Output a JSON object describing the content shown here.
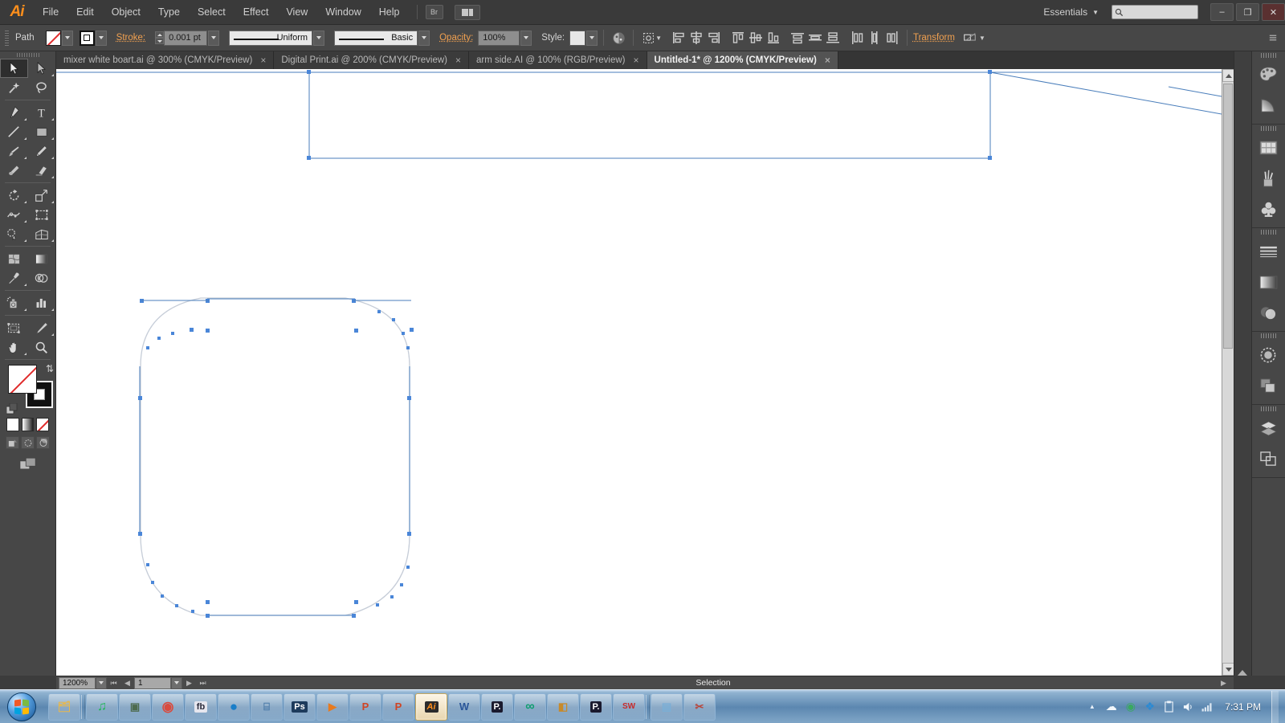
{
  "app": {
    "name": "Adobe Illustrator",
    "logo": "Ai",
    "bridge_label": "Br"
  },
  "menubar": {
    "items": [
      "File",
      "Edit",
      "Object",
      "Type",
      "Select",
      "Effect",
      "View",
      "Window",
      "Help"
    ],
    "workspace": "Essentials",
    "search_placeholder": "",
    "window_buttons": {
      "minimize": "–",
      "restore": "❐",
      "close": "✕"
    }
  },
  "controlbar": {
    "object_label": "Path",
    "fill_label": "",
    "stroke_label": "Stroke:",
    "stroke_weight": "0.001 pt",
    "stroke_profile": "Uniform",
    "brush_definition": "Basic",
    "opacity_label": "Opacity:",
    "opacity_value": "100%",
    "style_label": "Style:",
    "transform_label": "Transform",
    "align_icons": [
      "align-left-icon",
      "align-center-horizontal-icon",
      "align-right-icon",
      "align-top-icon",
      "align-middle-vertical-icon",
      "align-bottom-icon",
      "distribute-top-icon",
      "distribute-center-icon",
      "distribute-bottom-icon",
      "distribute-left-icon",
      "distribute-center-vertical-icon",
      "distribute-right-icon"
    ]
  },
  "tabs": [
    {
      "label": "mixer white boart.ai @ 300% (CMYK/Preview)",
      "active": false,
      "close": "×"
    },
    {
      "label": "Digital Print.ai @ 200% (CMYK/Preview)",
      "active": false,
      "close": "×"
    },
    {
      "label": "arm side.AI @ 100% (RGB/Preview)",
      "active": false,
      "close": "×"
    },
    {
      "label": "Untitled-1* @ 1200% (CMYK/Preview)",
      "active": true,
      "close": "×"
    }
  ],
  "toolbar": {
    "tools": [
      {
        "name": "selection-tool",
        "selected": true,
        "flyout": false
      },
      {
        "name": "direct-selection-tool",
        "selected": false,
        "flyout": true
      },
      {
        "name": "magic-wand-tool",
        "selected": false,
        "flyout": false
      },
      {
        "name": "lasso-tool",
        "selected": false,
        "flyout": false
      },
      {
        "name": "pen-tool",
        "selected": false,
        "flyout": true
      },
      {
        "name": "type-tool",
        "selected": false,
        "flyout": true
      },
      {
        "name": "line-segment-tool",
        "selected": false,
        "flyout": true
      },
      {
        "name": "rectangle-tool",
        "selected": false,
        "flyout": true
      },
      {
        "name": "paintbrush-tool",
        "selected": false,
        "flyout": true
      },
      {
        "name": "pencil-tool",
        "selected": false,
        "flyout": true
      },
      {
        "name": "blob-brush-tool",
        "selected": false,
        "flyout": false
      },
      {
        "name": "eraser-tool",
        "selected": false,
        "flyout": true
      },
      {
        "name": "rotate-tool",
        "selected": false,
        "flyout": true
      },
      {
        "name": "scale-tool",
        "selected": false,
        "flyout": true
      },
      {
        "name": "width-tool",
        "selected": false,
        "flyout": true
      },
      {
        "name": "free-transform-tool",
        "selected": false,
        "flyout": false
      },
      {
        "name": "shape-builder-tool",
        "selected": false,
        "flyout": true
      },
      {
        "name": "perspective-grid-tool",
        "selected": false,
        "flyout": true
      },
      {
        "name": "mesh-tool",
        "selected": false,
        "flyout": false
      },
      {
        "name": "gradient-tool",
        "selected": false,
        "flyout": false
      },
      {
        "name": "eyedropper-tool",
        "selected": false,
        "flyout": true
      },
      {
        "name": "blend-tool",
        "selected": false,
        "flyout": false
      },
      {
        "name": "symbol-sprayer-tool",
        "selected": false,
        "flyout": true
      },
      {
        "name": "column-graph-tool",
        "selected": false,
        "flyout": true
      },
      {
        "name": "artboard-tool",
        "selected": false,
        "flyout": false
      },
      {
        "name": "slice-tool",
        "selected": false,
        "flyout": true
      },
      {
        "name": "hand-tool",
        "selected": false,
        "flyout": true
      },
      {
        "name": "zoom-tool",
        "selected": false,
        "flyout": false
      }
    ],
    "fill_state": "none",
    "stroke_state": "black",
    "color_modes": [
      "color-mode-button",
      "gradient-mode-button",
      "none-mode-button"
    ],
    "draw_modes": [
      "draw-normal-button",
      "draw-behind-button",
      "draw-inside-button"
    ],
    "screen_mode": "screen-mode-button"
  },
  "right_dock": {
    "groups": [
      {
        "items": [
          "color-panel-icon",
          "color-guide-panel-icon"
        ]
      },
      {
        "items": [
          "swatches-panel-icon",
          "brushes-panel-icon",
          "symbols-panel-icon"
        ]
      },
      {
        "items": [
          "stroke-panel-icon",
          "gradient-panel-icon",
          "transparency-panel-icon"
        ]
      },
      {
        "items": [
          "appearance-panel-icon",
          "graphic-styles-panel-icon"
        ]
      },
      {
        "items": [
          "layers-panel-icon",
          "artboards-panel-icon"
        ]
      }
    ],
    "collapse_icon": "expand-panels-icon"
  },
  "statusbar": {
    "zoom_level": "1200%",
    "page_number": "1",
    "status_text": "Selection",
    "nav_first": "⏮",
    "nav_prev": "◀",
    "nav_next": "▶",
    "nav_last": "⏭"
  },
  "canvas": {
    "artboard_background": "#ffffff",
    "selection_color": "#4a7ebb",
    "anchor_color": "#4a86d8",
    "description": "Rounded-square vector path selected with visible anchor points, plus a partial rectangle path at top"
  },
  "taskbar": {
    "start_label": "Start",
    "items": [
      {
        "name": "taskbar-explorer",
        "label": "🗂",
        "color": "#e8b84b",
        "active": false
      },
      {
        "name": "taskbar-spotify",
        "label": "♫",
        "color": "#1db954",
        "active": false
      },
      {
        "name": "taskbar-monitor",
        "label": "▣",
        "color": "#5a7a5a",
        "active": false
      },
      {
        "name": "taskbar-chrome",
        "label": "◉",
        "color": "#d94b3e",
        "active": false
      },
      {
        "name": "taskbar-fb",
        "label": "fb",
        "color": "#2a2a3a",
        "active": false
      },
      {
        "name": "taskbar-teamviewer",
        "label": "●",
        "color": "#1a7ec8",
        "active": false
      },
      {
        "name": "taskbar-contacts",
        "label": "⌸",
        "color": "#4a7aa8",
        "active": false
      },
      {
        "name": "taskbar-photoshop",
        "label": "Ps",
        "color": "#1d3b5c",
        "active": false
      },
      {
        "name": "taskbar-media-player",
        "label": "▶",
        "color": "#e87a1e",
        "active": false
      },
      {
        "name": "taskbar-powerpoint-1",
        "label": "P",
        "color": "#d04423",
        "active": false
      },
      {
        "name": "taskbar-powerpoint-2",
        "label": "P",
        "color": "#d04423",
        "active": false
      },
      {
        "name": "taskbar-illustrator",
        "label": "Ai",
        "color": "#ff8f1c",
        "active": true
      },
      {
        "name": "taskbar-word",
        "label": "W",
        "color": "#2a5699",
        "active": false
      },
      {
        "name": "taskbar-pdf-1",
        "label": "P.",
        "color": "#1a1a2e",
        "active": false
      },
      {
        "name": "taskbar-opera",
        "label": "∞",
        "color": "#0e9e6e",
        "active": false
      },
      {
        "name": "taskbar-picture",
        "label": "◧",
        "color": "#c78a2a",
        "active": false
      },
      {
        "name": "taskbar-pdf-2",
        "label": "P.",
        "color": "#1a1a2e",
        "active": false
      },
      {
        "name": "taskbar-solidworks",
        "label": "SW",
        "color": "#c82a2a",
        "active": false
      },
      {
        "name": "taskbar-calculator",
        "label": "▤",
        "color": "#7aaed6",
        "active": false
      },
      {
        "name": "taskbar-tool",
        "label": "✂",
        "color": "#b8453a",
        "active": false
      }
    ],
    "tray": [
      {
        "name": "tray-show-hidden-icon",
        "glyph": "▲"
      },
      {
        "name": "tray-onedrive-icon",
        "glyph": "☁"
      },
      {
        "name": "tray-globe-icon",
        "glyph": "◉"
      },
      {
        "name": "tray-dropbox-icon",
        "glyph": "❖"
      },
      {
        "name": "tray-clipboard-icon",
        "glyph": "Ὄb"
      },
      {
        "name": "tray-volume-icon",
        "glyph": "🔊"
      },
      {
        "name": "tray-network-icon",
        "glyph": "▃"
      }
    ],
    "clock": "7:31 PM"
  }
}
